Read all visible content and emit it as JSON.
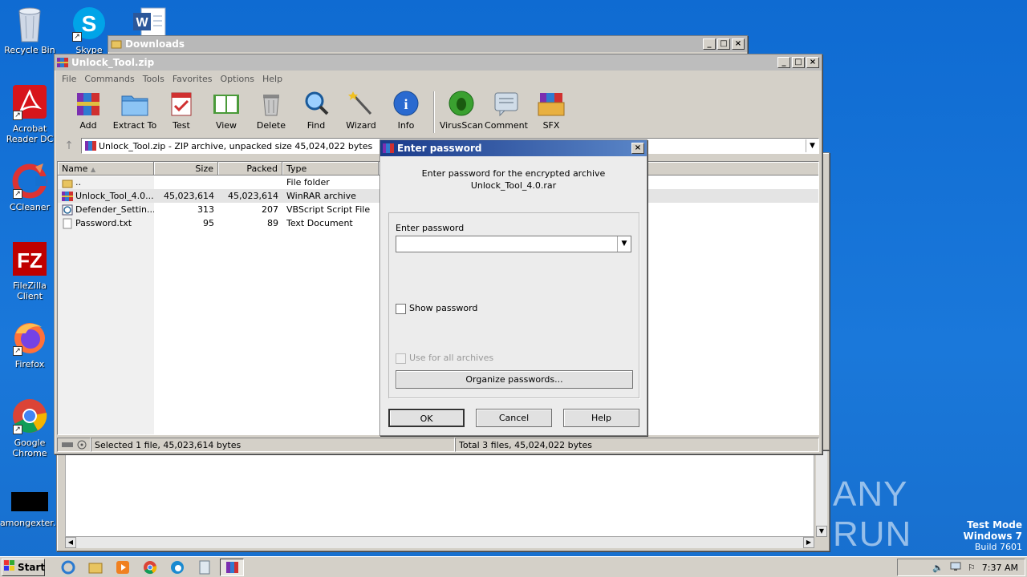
{
  "desktop": {
    "icons": [
      {
        "label": "Recycle Bin"
      },
      {
        "label": "Skype"
      },
      {
        "label": "Acrobat Reader DC"
      },
      {
        "label": "CCleaner"
      },
      {
        "label": "FileZilla Client"
      },
      {
        "label": "Firefox"
      },
      {
        "label": "Google Chrome"
      },
      {
        "label": "amongexter..."
      }
    ],
    "watermark": "ANY RUN",
    "test_mode": {
      "line1": "Test Mode",
      "line2": "Windows 7",
      "line3": "Build 7601"
    }
  },
  "downloads_window": {
    "title": "Downloads"
  },
  "winrar": {
    "title": "Unlock_Tool.zip",
    "menu": [
      "File",
      "Commands",
      "Tools",
      "Favorites",
      "Options",
      "Help"
    ],
    "toolbar": [
      {
        "label": "Add",
        "icon": "add-icon"
      },
      {
        "label": "Extract To",
        "icon": "extract-folder-icon"
      },
      {
        "label": "Test",
        "icon": "test-icon"
      },
      {
        "label": "View",
        "icon": "view-book-icon"
      },
      {
        "label": "Delete",
        "icon": "trash-icon"
      },
      {
        "label": "Find",
        "icon": "magnifier-icon"
      },
      {
        "label": "Wizard",
        "icon": "wand-icon"
      },
      {
        "label": "Info",
        "icon": "info-icon"
      },
      {
        "label": "VirusScan",
        "icon": "bug-icon"
      },
      {
        "label": "Comment",
        "icon": "comment-icon"
      },
      {
        "label": "SFX",
        "icon": "sfx-box-icon"
      }
    ],
    "address": "Unlock_Tool.zip - ZIP archive, unpacked size 45,024,022 bytes",
    "columns": {
      "name": "Name",
      "size": "Size",
      "packed": "Packed",
      "type": "Type"
    },
    "files": [
      {
        "name": "..",
        "size": "",
        "packed": "",
        "type": "File folder",
        "icon": "folder-up-icon"
      },
      {
        "name": "Unlock_Tool_4.0....",
        "size": "45,023,614",
        "packed": "45,023,614",
        "type": "WinRAR archive",
        "icon": "rar-icon"
      },
      {
        "name": "Defender_Settin...",
        "size": "313",
        "packed": "207",
        "type": "VBScript Script File",
        "icon": "script-icon"
      },
      {
        "name": "Password.txt",
        "size": "95",
        "packed": "89",
        "type": "Text Document",
        "icon": "text-file-icon"
      }
    ],
    "status_left": "Selected 1 file, 45,023,614 bytes",
    "status_right": "Total 3 files, 45,024,022 bytes"
  },
  "password_dialog": {
    "title": "Enter password",
    "message_line1": "Enter password for the encrypted archive",
    "message_line2": "Unlock_Tool_4.0.rar",
    "field_label": "Enter password",
    "field_value": "",
    "show_password": "Show password",
    "use_for_all": "Use for all archives",
    "organize": "Organize passwords...",
    "ok": "OK",
    "cancel": "Cancel",
    "help": "Help"
  },
  "taskbar": {
    "start": "Start",
    "clock": "7:37 AM"
  }
}
